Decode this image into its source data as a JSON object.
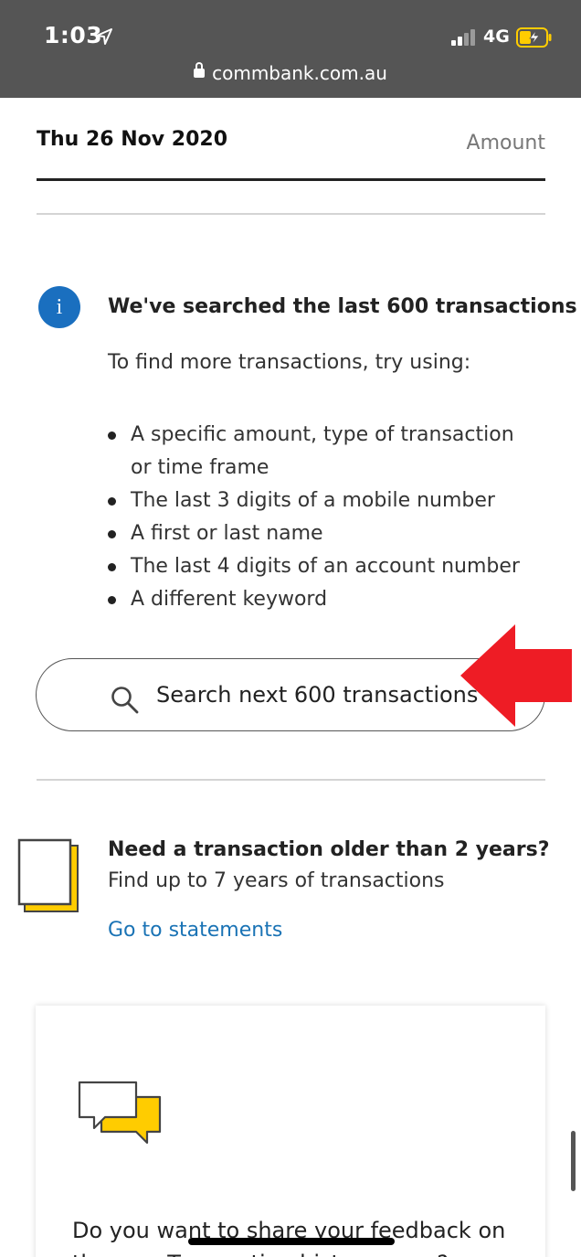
{
  "status_bar": {
    "time": "1:03",
    "network": "4G",
    "url": "commbank.com.au",
    "icons": [
      "location-arrow-icon",
      "signal-icon",
      "battery-charging-icon",
      "lock-icon"
    ]
  },
  "header": {
    "date": "Thu 26 Nov 2020",
    "amount_label": "Amount"
  },
  "notice": {
    "icon": "info-icon",
    "icon_glyph": "i",
    "title": "We've searched the last 600 transactions",
    "subtitle": "To find more transactions, try using:",
    "tips": [
      "A specific amount, type of transaction or time frame",
      "The last 3 digits of a mobile number",
      "A first or last name",
      "The last 4 digits of an account number",
      "A different keyword"
    ]
  },
  "search_button": {
    "icon": "search-icon",
    "label": "Search next 600 transactions"
  },
  "older": {
    "icon": "document-stack-icon",
    "title": "Need a transaction older than 2 years?",
    "subtitle": "Find up to 7 years of transactions",
    "link": "Go to statements"
  },
  "feedback": {
    "icon": "chat-bubbles-icon",
    "text": "Do you want to share your feedback on the new Transaction history page?"
  },
  "colors": {
    "status_bar": "#555555",
    "info_blue": "#1a6fbf",
    "link_blue": "#1a73b5",
    "accent_yellow": "#ffcc00",
    "annotation_red": "#ee1c25"
  }
}
